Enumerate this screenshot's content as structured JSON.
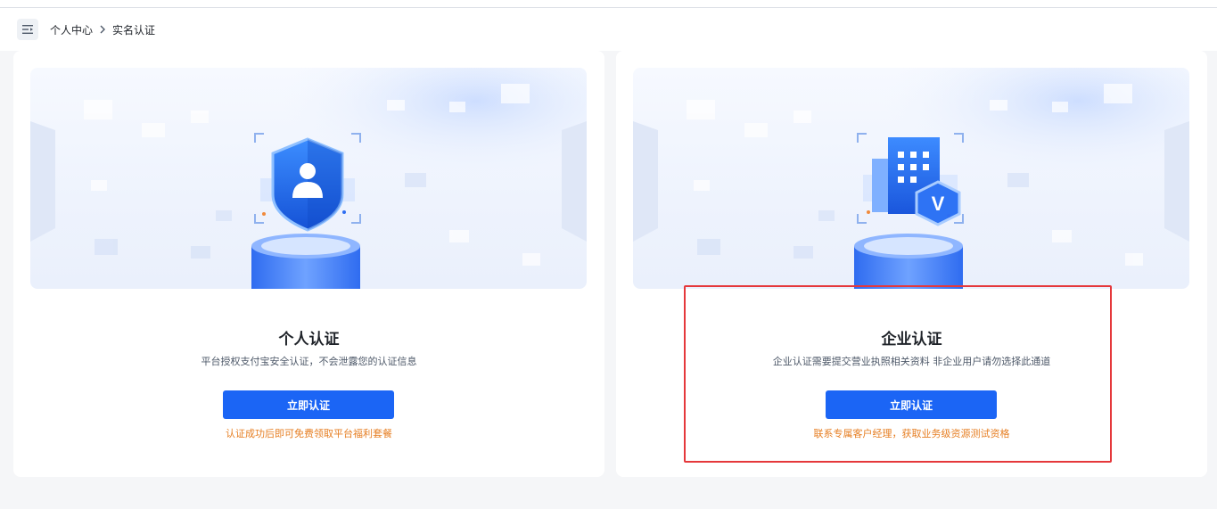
{
  "breadcrumb": {
    "items": [
      "个人中心",
      "实名认证"
    ]
  },
  "cards": [
    {
      "title": "个人认证",
      "description": "平台授权支付宝安全认证，不会泄露您的认证信息",
      "button_label": "立即认证",
      "note": "认证成功后即可免费领取平台福利套餐"
    },
    {
      "title": "企业认证",
      "description": "企业认证需要提交营业执照相关资料 非企业用户请勿选择此通道",
      "button_label": "立即认证",
      "note": "联系专属客户经理，获取业务级资源测试资格"
    }
  ],
  "colors": {
    "primary": "#1b65f5",
    "note": "#e67e22",
    "highlight": "#e5383b"
  }
}
